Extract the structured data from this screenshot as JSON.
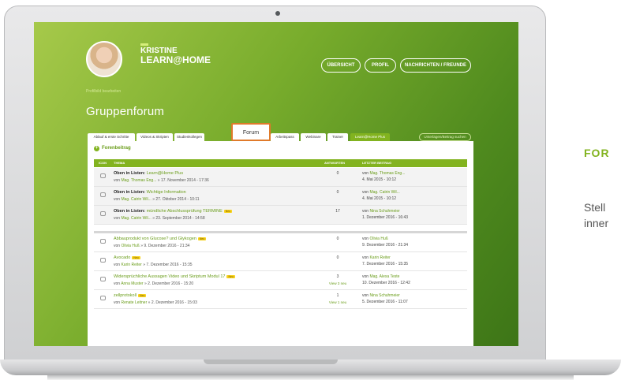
{
  "profile": {
    "name_line1": "KRISTINE",
    "name_line2": "LEARN@HOME",
    "edit_link": "Profilbild bearbeiten"
  },
  "nav": {
    "overview": "ÜBERSICHT",
    "profile": "PROFIL",
    "messages": "NACHRICHTEN / FREUNDE"
  },
  "page_title": "Gruppenforum",
  "tabs": [
    {
      "label": "Ablauf & erste Schritte"
    },
    {
      "label": "Videos & Skripten"
    },
    {
      "label": "Studienkollegen"
    },
    {
      "label": "Forum"
    },
    {
      "label": "Arbeitspass"
    },
    {
      "label": "Webinare"
    },
    {
      "label": "Trainer"
    },
    {
      "label": "Learn@Home Plus"
    }
  ],
  "search_placeholder": "Unterlagen/Beitrag suchen",
  "new_post_label": "Forenbeitrag",
  "table": {
    "col_icon": "ICON",
    "col_topic": "THEMA",
    "col_answers": "ANTWORTEN",
    "col_last": "LETZTER BEITRAG"
  },
  "rows": [
    {
      "prefix": "Oben in Listen:",
      "title": "Learn@Home Plus",
      "by": "Mag. Thomas Eng...",
      "date": "» 17. November 2014 - 17:36",
      "answers": "0",
      "answers_new": "",
      "last_by": "Mag. Thomas Eng...",
      "last_date": "4. Mai 2015 - 10:12"
    },
    {
      "prefix": "Oben in Listen:",
      "title": "Wichtige Information",
      "by": "Mag. Catrin Wil...",
      "date": "» 27. Oktober 2014 - 10:11",
      "answers": "0",
      "answers_new": "",
      "last_by": "Mag. Catrin Wil...",
      "last_date": "4. Mai 2015 - 10:12"
    },
    {
      "prefix": "Oben in Listen:",
      "title": "mündliche Abschlussprüfung TERMINE",
      "by": "Mag. Catrin Wil...",
      "date": "» 23. September 2014 - 14:58",
      "answers": "17",
      "answers_new": "",
      "last_by": "Nina Schuhmeier",
      "last_date": "1. Dezember 2016 - 16:43"
    },
    {
      "prefix": "",
      "title": "Abbauprodukt von Glucose? und Glykogen",
      "by": "Olivia Huß",
      "date": "» 9. Dezember 2016 - 21:34",
      "answers": "0",
      "answers_new": "",
      "last_by": "Olivia Huß",
      "last_date": "9. Dezember 2016 - 21:34"
    },
    {
      "prefix": "",
      "title": "Avocado",
      "by": "Karin Reiter",
      "date": "» 7. Dezember 2016 - 15:35",
      "answers": "0",
      "answers_new": "",
      "last_by": "Karin Reiter",
      "last_date": "7. Dezember 2016 - 15:35"
    },
    {
      "prefix": "",
      "title": "Widersprüchliche Aussagen Video und Skriptum Modul 17",
      "by": "Anna Muster",
      "date": "» 2. Dezember 2016 - 15:20",
      "answers": "3",
      "answers_new": "View 3 neu",
      "last_by": "Mag. Alexa Teste",
      "last_date": "10. Dezember 2016 - 12:42"
    },
    {
      "prefix": "",
      "title": "zellprotokoll",
      "by": "Renate Leitner",
      "date": "» 2. Dezember 2016 - 15:03",
      "answers": "1",
      "answers_new": "View 1 neu",
      "last_by": "Nina Schuhmeier",
      "last_date": "5. Dezember 2016 - 11:07"
    }
  ],
  "labels": {
    "by": "von",
    "new_badge": "Neu"
  },
  "side": {
    "title": "FOR",
    "text_line1": "Stell",
    "text_line2": "inner"
  },
  "colors": {
    "accent": "#82b31f",
    "highlight": "#e07a2a"
  }
}
